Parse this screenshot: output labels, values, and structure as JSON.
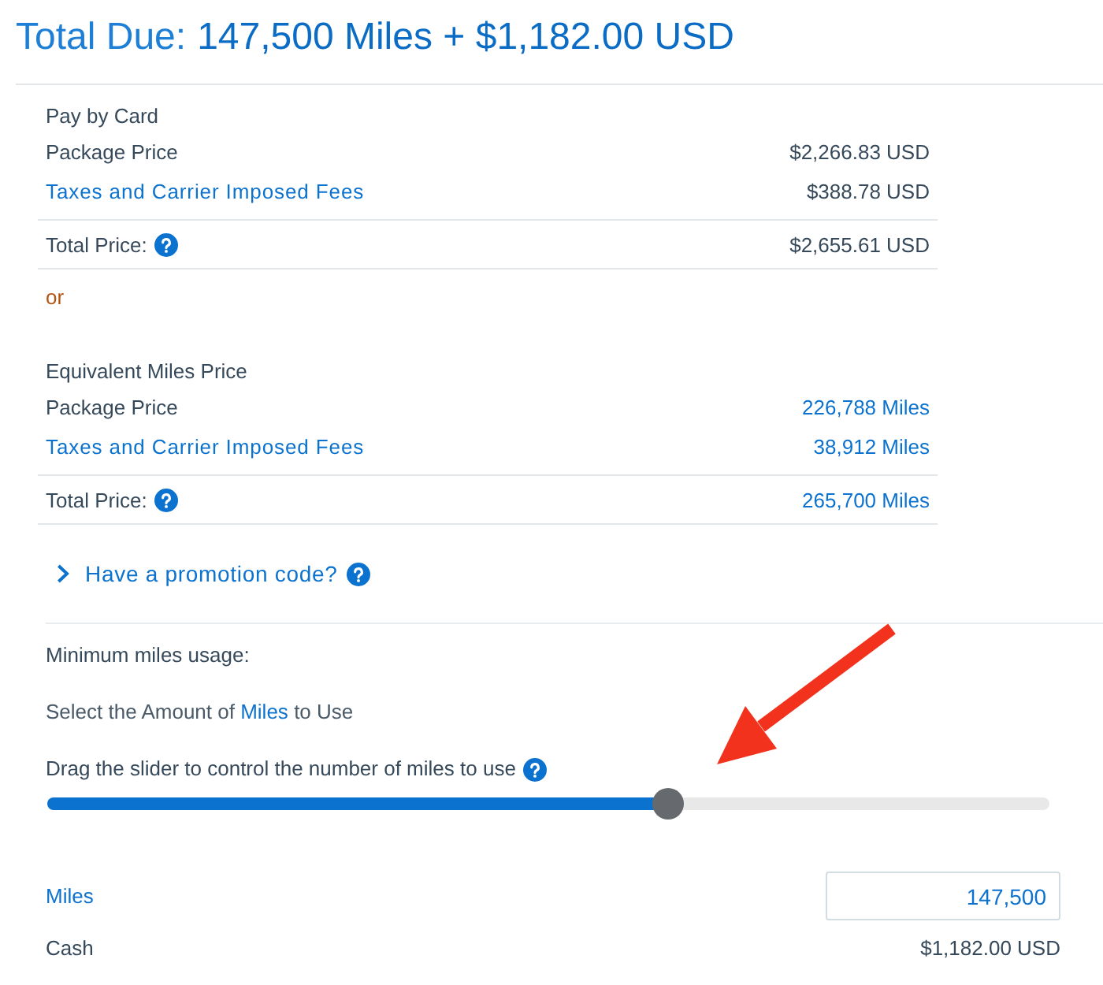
{
  "header": {
    "label": "Total Due:",
    "amount": "147,500 Miles + $1,182.00 USD"
  },
  "price_options": [
    {
      "kind": "cash",
      "heading": "Pay by Card",
      "rows": [
        {
          "label": "Package Price",
          "kind": "text",
          "value": "$2,266.83 USD"
        },
        {
          "label": "Taxes and Carrier Imposed Fees",
          "kind": "link",
          "value": "$388.78 USD"
        }
      ],
      "total": {
        "label": "Total Price:",
        "value": "$2,655.61 USD"
      }
    },
    {
      "kind": "miles",
      "heading": "Equivalent Miles Price",
      "rows": [
        {
          "label": "Package Price",
          "kind": "text",
          "value": "226,788 Miles"
        },
        {
          "label": "Taxes and Carrier Imposed Fees",
          "kind": "link",
          "value": "38,912 Miles"
        }
      ],
      "total": {
        "label": "Total Price:",
        "value": "265,700 Miles"
      }
    }
  ],
  "separator": "or",
  "promotion": {
    "label": "Have a promotion code?",
    "expanded": false
  },
  "miles_usage": {
    "minimum_label": "Minimum miles usage:",
    "select_text": [
      {
        "text": "Select the Amount of",
        "kind": "text"
      },
      {
        "text": "Miles",
        "kind": "link"
      },
      {
        "text": "to Use",
        "kind": "text"
      }
    ],
    "instruction": "Drag the slider to control the number of miles to use",
    "slider": {
      "level": 0.62
    }
  },
  "payment_split": [
    {
      "label": "Miles",
      "kind": "input",
      "value": "147,500"
    },
    {
      "label": "Cash",
      "kind": "text",
      "value": "$1,182.00 USD"
    }
  ]
}
